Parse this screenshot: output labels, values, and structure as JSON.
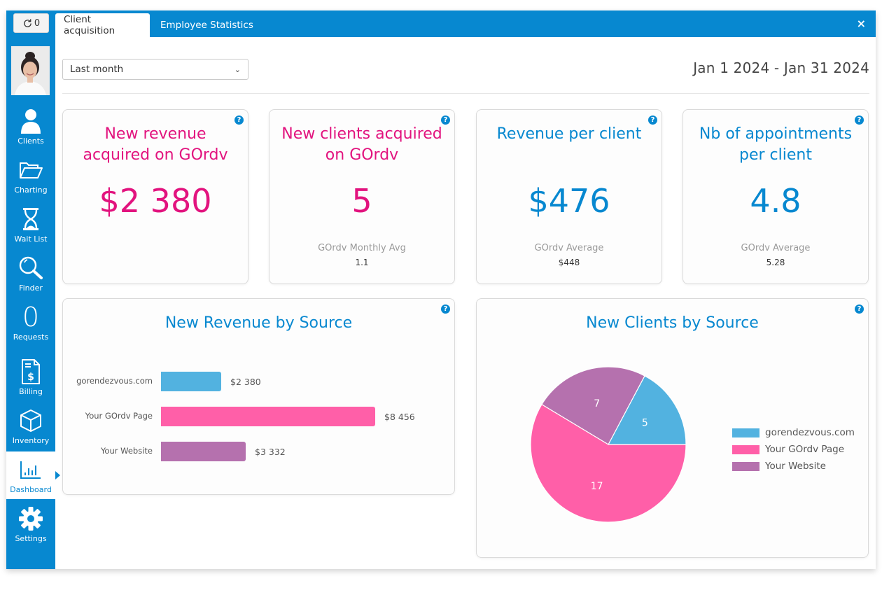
{
  "refresh": {
    "count": "0",
    "icon": "refresh-icon"
  },
  "sidebar": {
    "items": [
      {
        "label": "Clients",
        "icon": "user-icon"
      },
      {
        "label": "Charting",
        "icon": "folder-open-icon"
      },
      {
        "label": "Wait List",
        "icon": "hourglass-icon"
      },
      {
        "label": "Finder",
        "icon": "search-icon"
      },
      {
        "label": "Requests",
        "icon": "requests-count",
        "count": "0"
      },
      {
        "label": "Billing",
        "icon": "invoice-dollar-icon"
      },
      {
        "label": "Inventory",
        "icon": "box-icon"
      },
      {
        "label": "Dashboard",
        "icon": "bar-chart-icon",
        "active": true
      },
      {
        "label": "Settings",
        "icon": "gear-icon"
      }
    ]
  },
  "tabs": [
    {
      "label": "Client acquisition",
      "active": true
    },
    {
      "label": "Employee Statistics",
      "active": false
    }
  ],
  "close_label": "×",
  "filter": {
    "selected": "Last month"
  },
  "date_range": "Jan 1 2024 - Jan 31 2024",
  "colors": {
    "primary": "#0788d0",
    "pink": "#e2137e",
    "series_blue": "#52b2e0",
    "series_pink": "#ff5fa8",
    "series_purple": "#b571ae"
  },
  "kpis": [
    {
      "title": "New revenue acquired on GOrdv",
      "value": "$2 380",
      "sub_label": "",
      "sub_value": ""
    },
    {
      "title": "New clients acquired on GOrdv",
      "value": "5",
      "sub_label": "GOrdv Monthly Avg",
      "sub_value": "1.1"
    },
    {
      "title": "Revenue per client",
      "value": "$476",
      "sub_label": "GOrdv Average",
      "sub_value": "$448"
    },
    {
      "title": "Nb of appointments per client",
      "value": "4.8",
      "sub_label": "GOrdv Average",
      "sub_value": "5.28"
    }
  ],
  "chart_data": [
    {
      "type": "bar",
      "orientation": "horizontal",
      "title": "New Revenue by Source",
      "categories": [
        "gorendezvous.com",
        "Your GOrdv Page",
        "Your Website"
      ],
      "values": [
        2380,
        8456,
        3332
      ],
      "value_labels": [
        "$2 380",
        "$8 456",
        "$3 332"
      ],
      "colors": [
        "#52b2e0",
        "#ff5fa8",
        "#b571ae"
      ],
      "xlabel": "",
      "ylabel": "",
      "grid": false
    },
    {
      "type": "pie",
      "title": "New Clients by Source",
      "categories": [
        "gorendezvous.com",
        "Your GOrdv Page",
        "Your Website"
      ],
      "values": [
        5,
        17,
        7
      ],
      "value_labels": [
        "5",
        "17",
        "7"
      ],
      "colors": [
        "#52b2e0",
        "#ff5fa8",
        "#b571ae"
      ],
      "legend": "right"
    }
  ]
}
